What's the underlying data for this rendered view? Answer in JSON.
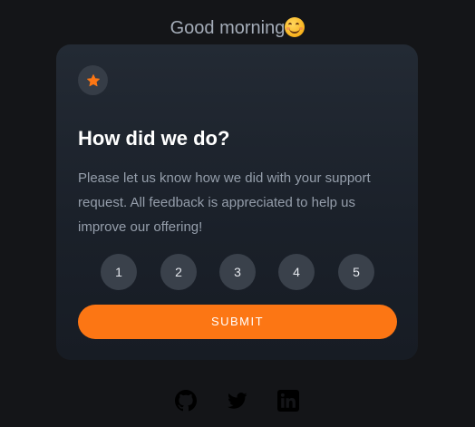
{
  "greeting": {
    "text": "Good morning",
    "emoji_icon": "smiling-face-emoji"
  },
  "card": {
    "badge_icon": "star-icon",
    "accent_color": "#fc7614",
    "title": "How did we do?",
    "body": "Please let us know how we did with your support request. All feedback is appreciated to help us improve our offering!",
    "ratings": [
      "1",
      "2",
      "3",
      "4",
      "5"
    ],
    "submit_label": "SUBMIT"
  },
  "footer": {
    "social_icons": [
      "github-icon",
      "twitter-icon",
      "linkedin-icon"
    ]
  }
}
